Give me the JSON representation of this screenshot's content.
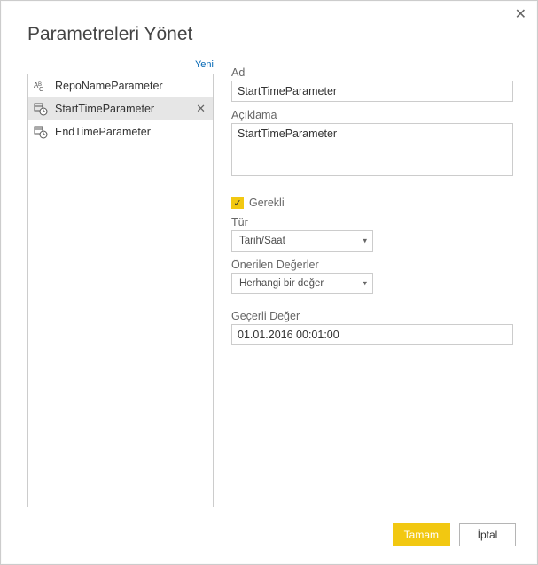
{
  "title": "Parametreleri Yönet",
  "new_link": "Yeni",
  "parameters": [
    {
      "name": "RepoNameParameter",
      "icon": "abc"
    },
    {
      "name": "StartTimeParameter",
      "icon": "datetime",
      "selected": true
    },
    {
      "name": "EndTimeParameter",
      "icon": "datetime"
    }
  ],
  "form": {
    "name_label": "Ad",
    "name_value": "StartTimeParameter",
    "desc_label": "Açıklama",
    "desc_value": "StartTimeParameter",
    "required_label": "Gerekli",
    "required_checked": true,
    "type_label": "Tür",
    "type_value": "Tarih/Saat",
    "suggested_label": "Önerilen Değerler",
    "suggested_value": "Herhangi bir değer",
    "current_label": "Geçerli Değer",
    "current_value": "01.01.2016 00:01:00"
  },
  "buttons": {
    "ok": "Tamam",
    "cancel": "İptal"
  },
  "colors": {
    "accent": "#F2C811"
  }
}
